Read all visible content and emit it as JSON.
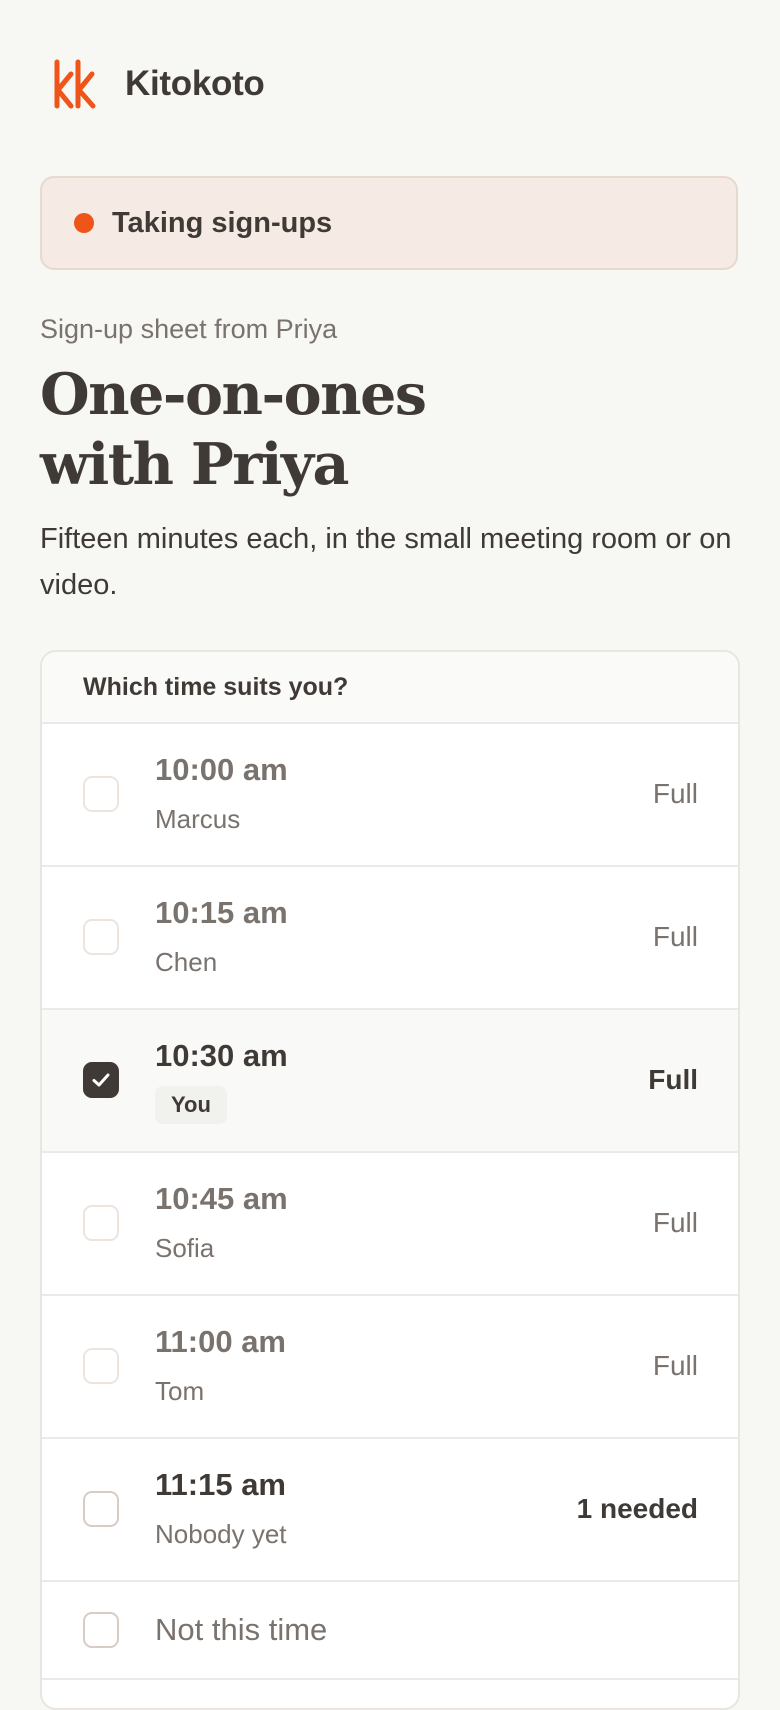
{
  "brand": {
    "name": "Kitokoto",
    "logo_icon": "kk-logo-icon",
    "accent": "#ef5418"
  },
  "status": {
    "label": "Taking sign-ups",
    "dot_color": "#ef5418"
  },
  "page": {
    "eyebrow": "Sign-up sheet from Priya",
    "title_line1": "One-on-ones",
    "title_line2": "with Priya",
    "description": "Fifteen minutes each, in the small meeting room or on video."
  },
  "card": {
    "question": "Which time suits you?",
    "slots": [
      {
        "time": "10:00 am",
        "who": "Marcus",
        "status": "Full",
        "checked": false
      },
      {
        "time": "10:15 am",
        "who": "Chen",
        "status": "Full",
        "checked": false
      },
      {
        "time": "10:30 am",
        "badge": "You",
        "status": "Full",
        "checked": true
      },
      {
        "time": "10:45 am",
        "who": "Sofia",
        "status": "Full",
        "checked": false
      },
      {
        "time": "11:00 am",
        "who": "Tom",
        "status": "Full",
        "checked": false
      },
      {
        "time": "11:15 am",
        "who": "Nobody yet",
        "status": "1 needed",
        "checked": false
      }
    ],
    "none_option": {
      "label": "Not this time",
      "checked": false
    }
  }
}
